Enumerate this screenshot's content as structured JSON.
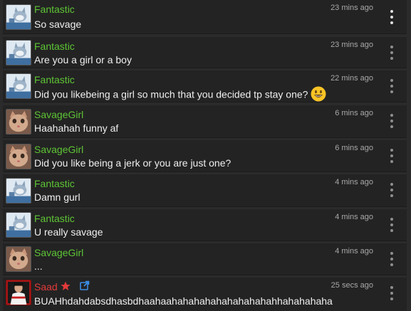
{
  "messages": [
    {
      "user": "Fantastic",
      "avatar": "tom-cat-avatar",
      "text": "So savage",
      "time": "23 mins ago"
    },
    {
      "user": "Fantastic",
      "avatar": "tom-cat-avatar",
      "text": "Are you a girl or a boy",
      "time": "23 mins ago"
    },
    {
      "user": "Fantastic",
      "avatar": "tom-cat-avatar",
      "text": "Did you likebeing a girl so much that you decided tp stay one?",
      "time": "22 mins ago",
      "emoji": "grinning-face-emoji"
    },
    {
      "user": "SavageGirl",
      "avatar": "kitten-avatar",
      "text": "Haahahah funny af",
      "time": "6 mins ago"
    },
    {
      "user": "SavageGirl",
      "avatar": "kitten-avatar",
      "text": "Did you like being a jerk or you are just one?",
      "time": "6 mins ago"
    },
    {
      "user": "Fantastic",
      "avatar": "tom-cat-avatar",
      "text": "Damn gurl",
      "time": "4 mins ago"
    },
    {
      "user": "Fantastic",
      "avatar": "tom-cat-avatar",
      "text": "U really savage",
      "time": "4 mins ago"
    },
    {
      "user": "SavageGirl",
      "avatar": "kitten-avatar",
      "text": "...",
      "time": "4 mins ago"
    },
    {
      "user": "Saad",
      "avatar": "saad-avatar",
      "text": "BUAHhdahdabsdhasbdhaahaahahahahahahahahahahhahahahaha",
      "time": "25 secs ago",
      "badges": [
        "star-icon",
        "share-icon"
      ]
    }
  ],
  "colors": {
    "username_green": "#5ec535",
    "username_red": "#e23a3a",
    "message_bg": "#232323",
    "text": "#efefef",
    "timestamp": "#a8a8a8"
  },
  "icons": {
    "menu": "vertical-dots-icon"
  }
}
